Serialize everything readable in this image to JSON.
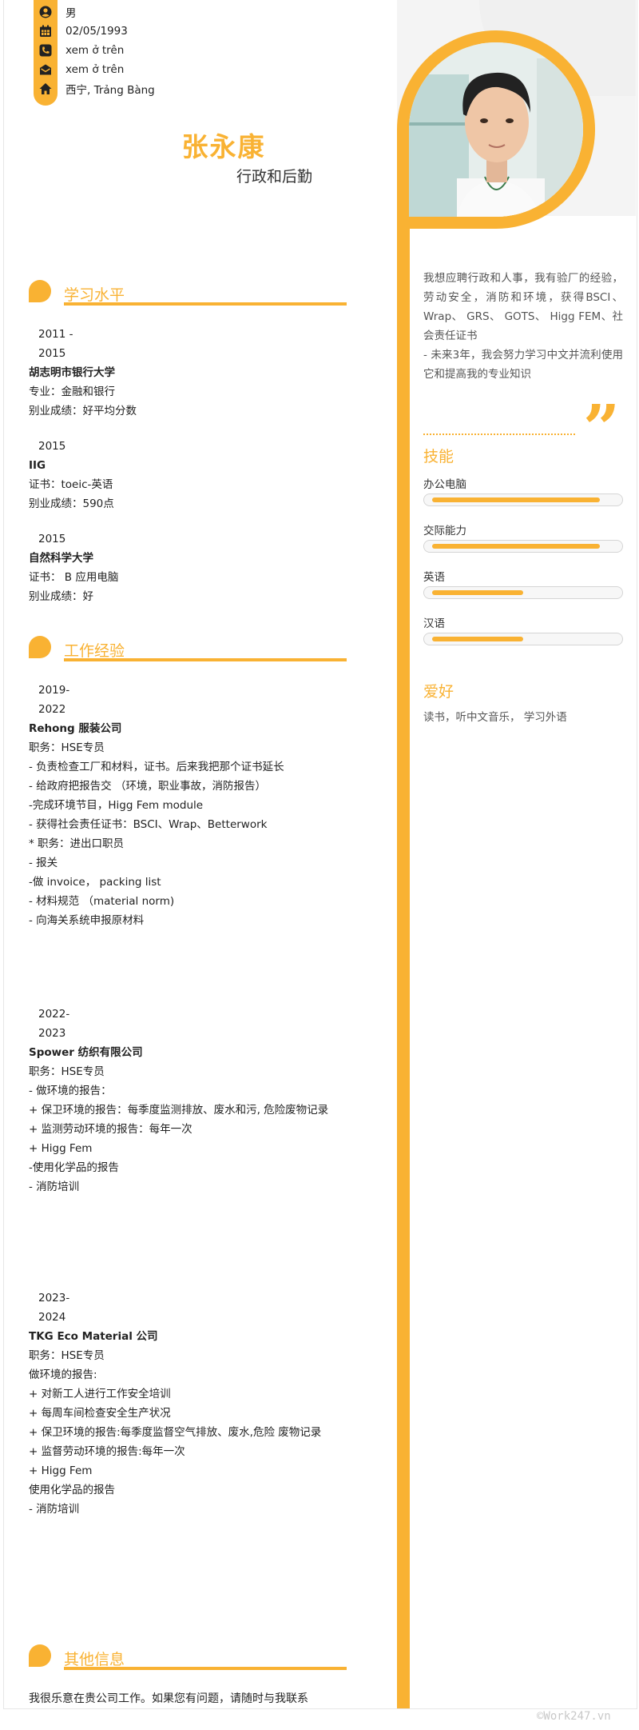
{
  "contact": {
    "gender": "男",
    "birthday": "02/05/1993",
    "phone": "xem ở trên",
    "email": "xem ở trên",
    "address": "西宁, Trảng Bàng"
  },
  "profile": {
    "name": "张永康",
    "job_title": "行政和后勤"
  },
  "summary": [
    "我想应聘行政和人事，我有验厂的经验， 劳动安全，消防和环境，获得BSCI、 Wrap、 GRS、 GOTS、 Higg FEM、社会责任证书",
    "- 未来3年，我会努力学习中文并流利使用它和提高我的专业知识"
  ],
  "education": {
    "title": "学习水平",
    "items": [
      {
        "date1": "2011 -",
        "date2": "2015",
        "school": "胡志明市银行大学",
        "line1": "专业：金融和银行",
        "line2": "别业成绩：好平均分数"
      },
      {
        "date1": "2015",
        "school": "IIG",
        "line1": "证书：toeic-英语",
        "line2": "别业成绩：590点"
      },
      {
        "date1": "2015",
        "school": "自然科学大学",
        "line1": "证书： B 应用电脑",
        "line2": "别业成绩：好"
      }
    ]
  },
  "work": {
    "title": "工作经验",
    "items": [
      {
        "date1": "2019-",
        "date2": "2022",
        "company": "Rehong 服装公司",
        "lines": [
          "职务：HSE专员",
          "- 负责检查工厂和材料，证书。后来我把那个证书延长",
          "- 给政府把报告交 （环境，职业事故，消防报告）",
          "-完成环境节目，Higg Fem module",
          "- 获得社会责任证书：BSCI、Wrap、Betterwork",
          "* 职务：进出口职员",
          "- 报关",
          "-做 invoice， packing list",
          "- 材料规范 （material norm)",
          "- 向海关系统申报原材料"
        ]
      },
      {
        "date1": "2022-",
        "date2": "2023",
        "company": "Spower 纺织有限公司",
        "lines": [
          "职务：HSE专员",
          "- 做环境的报告：",
          "+ 保卫环境的报告：每季度监测排放、废水和污, 危险废物记录",
          "+ 监测劳动环境的报告：每年一次",
          "+ Higg Fem",
          "-使用化学品的报告",
          "- 消防培训"
        ]
      },
      {
        "date1": "2023-",
        "date2": "2024",
        "company": "TKG Eco Material 公司",
        "lines": [
          "职务：HSE专员",
          "做环境的报告:",
          "+ 对新工人进行工作安全培训",
          "+ 每周车间检查安全生产状况",
          "+ 保卫环境的报告:每季度监督空气排放、废水,危险 废物记录",
          "+ 监督劳动环境的报告:每年一次",
          "+ Higg Fem",
          "使用化学品的报告",
          "- 消防培训"
        ]
      }
    ]
  },
  "other": {
    "title": "其他信息",
    "text": "我很乐意在贵公司工作。如果您有问题，请随时与我联系"
  },
  "skills": {
    "title": "技能",
    "items": [
      {
        "label": "办公电脑",
        "level": 0.92
      },
      {
        "label": "交际能力",
        "level": 0.92
      },
      {
        "label": "英语",
        "level": 0.5
      },
      {
        "label": "汉语",
        "level": 0.5
      }
    ]
  },
  "hobbies": {
    "title": "爱好",
    "text": "读书，听中文音乐， 学习外语"
  },
  "watermark": "©Work247.vn",
  "colors": {
    "accent": "#f9b233"
  }
}
